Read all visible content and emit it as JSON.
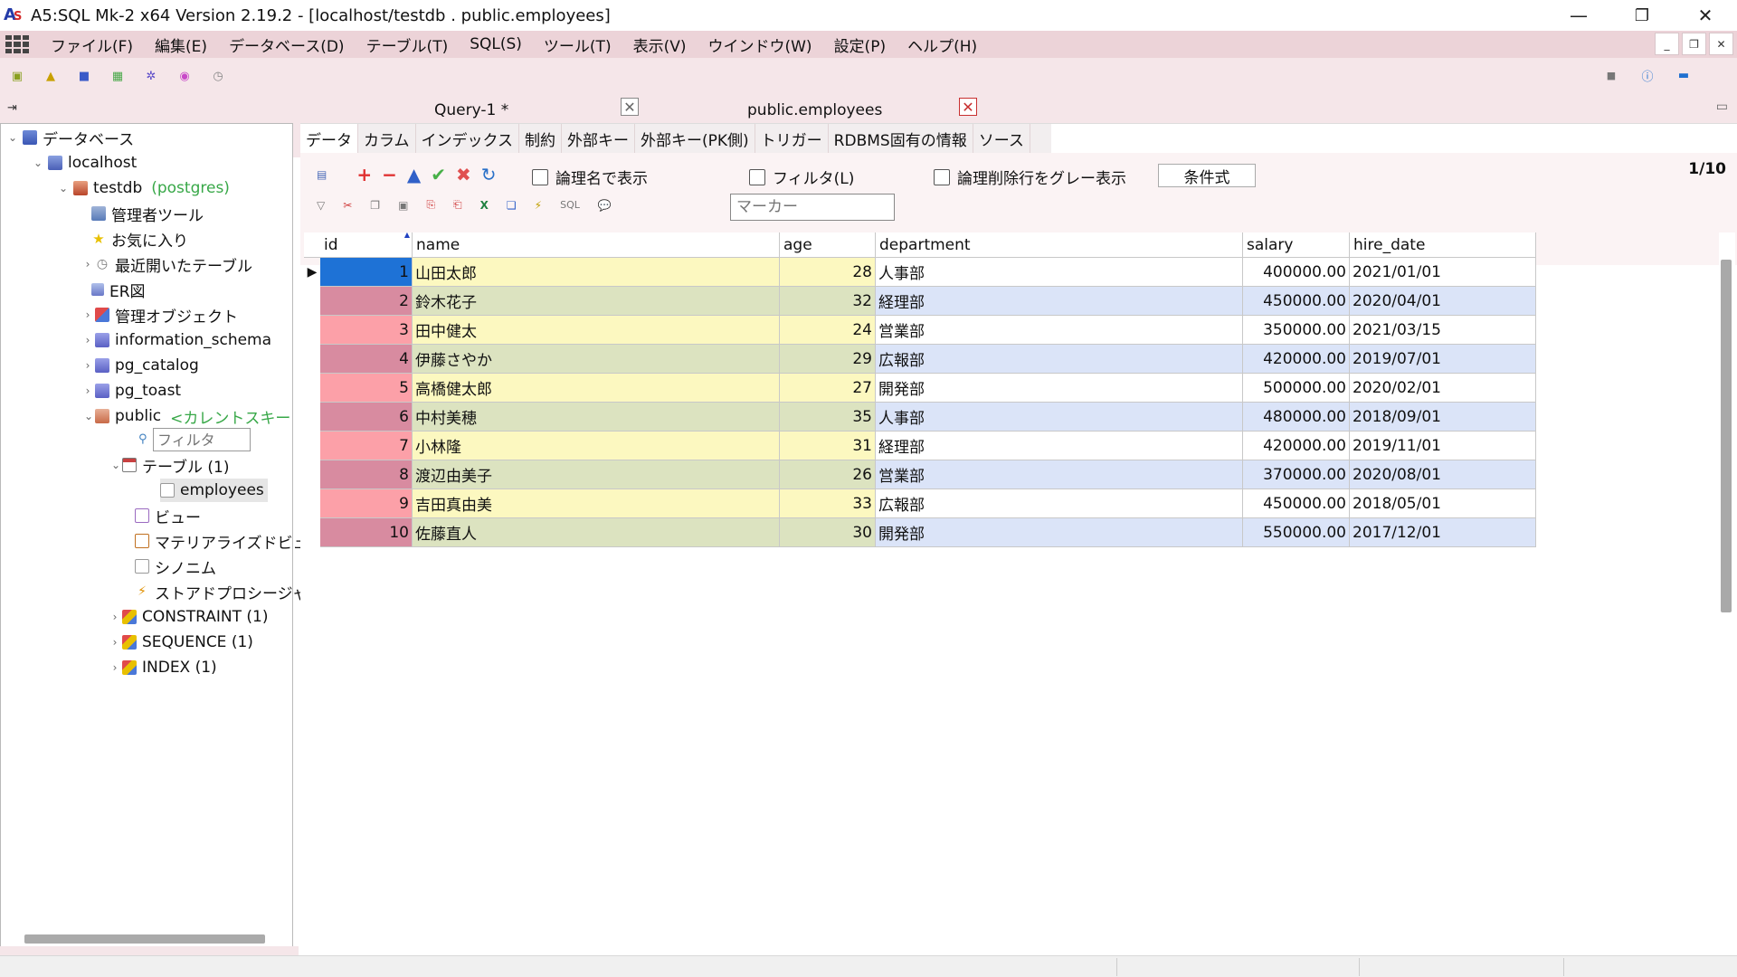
{
  "window": {
    "title": "A5:SQL Mk-2 x64 Version 2.19.2 - [localhost/testdb . public.employees]",
    "minimize": "—",
    "maximize": "❐",
    "close": "✕"
  },
  "menu": [
    "ファイル(F)",
    "編集(E)",
    "データベース(D)",
    "テーブル(T)",
    "SQL(S)",
    "ツール(T)",
    "表示(V)",
    "ウインドウ(W)",
    "設定(P)",
    "ヘルプ(H)"
  ],
  "mdi": {
    "minimize": "_",
    "restore": "❐",
    "close": "✕"
  },
  "tree": {
    "root": "データベース",
    "server": "localhost",
    "database": "testdb",
    "database_driver": "(postgres)",
    "items": [
      "管理者ツール",
      "お気に入り",
      "最近開いたテーブル",
      "ER図",
      "管理オブジェクト",
      "information_schema",
      "pg_catalog",
      "pg_toast"
    ],
    "schema": "public",
    "schema_note": "<カレントスキーマ>",
    "filter_placeholder": "フィルタ",
    "tables_label": "テーブル (1)",
    "table_item": "employees",
    "views": "ビュー",
    "matviews": "マテリアライズドビュー",
    "synonyms": "シノニム",
    "procs": "ストアドプロシージャ",
    "constraint": "CONSTRAINT (1)",
    "sequence": "SEQUENCE (1)",
    "index": "INDEX (1)"
  },
  "doc_tabs": [
    {
      "label": "Query-1 *"
    },
    {
      "label": "public.employees"
    }
  ],
  "sub_tabs": [
    "データ",
    "カラム",
    "インデックス",
    "制約",
    "外部キー",
    "外部キー(PK側)",
    "トリガー",
    "RDBMS固有の情報",
    "ソース"
  ],
  "options": {
    "logical_names": "論理名で表示",
    "filter": "フィルタ(L)",
    "gray_deleted": "論理削除行をグレー表示",
    "condition_button": "条件式",
    "page": "1/10",
    "marker_placeholder": "マーカー"
  },
  "grid": {
    "columns": [
      "id",
      "name",
      "age",
      "department",
      "salary",
      "hire_date"
    ],
    "rows": [
      [
        "1",
        "山田太郎",
        "28",
        "人事部",
        "400000.00",
        "2021/01/01"
      ],
      [
        "2",
        "鈴木花子",
        "32",
        "経理部",
        "450000.00",
        "2020/04/01"
      ],
      [
        "3",
        "田中健太",
        "24",
        "営業部",
        "350000.00",
        "2021/03/15"
      ],
      [
        "4",
        "伊藤さやか",
        "29",
        "広報部",
        "420000.00",
        "2019/07/01"
      ],
      [
        "5",
        "高橋健太郎",
        "27",
        "開発部",
        "500000.00",
        "2020/02/01"
      ],
      [
        "6",
        "中村美穂",
        "35",
        "人事部",
        "480000.00",
        "2018/09/01"
      ],
      [
        "7",
        "小林隆",
        "31",
        "経理部",
        "420000.00",
        "2019/11/01"
      ],
      [
        "8",
        "渡辺由美子",
        "26",
        "営業部",
        "370000.00",
        "2020/08/01"
      ],
      [
        "9",
        "吉田真由美",
        "33",
        "広報部",
        "450000.00",
        "2018/05/01"
      ],
      [
        "10",
        "佐藤直人",
        "30",
        "開発部",
        "550000.00",
        "2017/12/01"
      ]
    ]
  },
  "colors": {
    "chrome": "#f5e6e9",
    "menubar": "#ecd3d8",
    "id_even": "#d88ba0",
    "id_odd": "#fca0a8",
    "name_even": "#dce3c0",
    "name_odd": "#fcf8c0",
    "dept_even": "#dbe4f8",
    "dept_odd": "#ffffff",
    "selected": "#1e72d6"
  }
}
